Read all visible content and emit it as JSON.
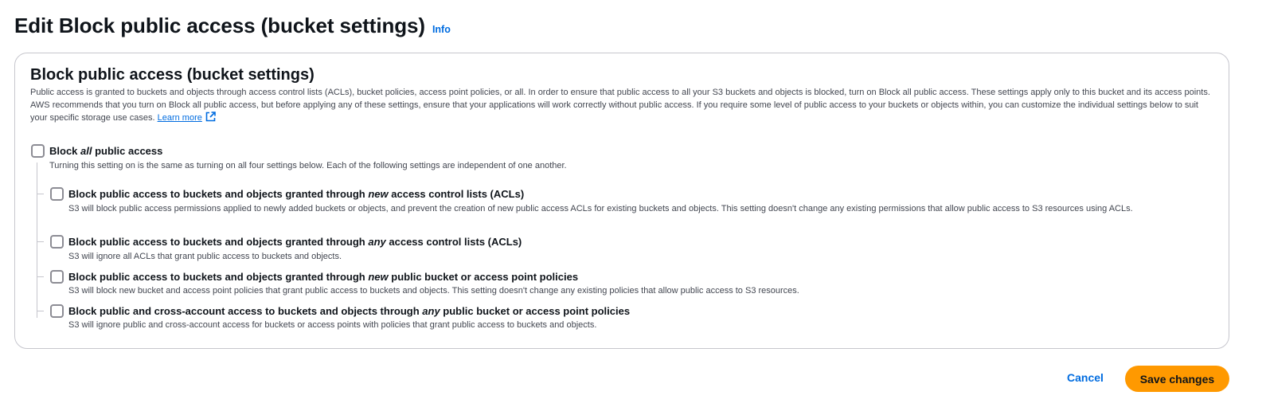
{
  "header": {
    "title": "Edit Block public access (bucket settings)",
    "info_label": "Info"
  },
  "panel": {
    "title": "Block public access (bucket settings)",
    "description": "Public access is granted to buckets and objects through access control lists (ACLs), bucket policies, access point policies, or all. In order to ensure that public access to all your S3 buckets and objects is blocked, turn on Block all public access. These settings apply only to this bucket and its access points. AWS recommends that you turn on Block all public access, but before applying any of these settings, ensure that your applications will work correctly without public access. If you require some level of public access to your buckets or objects within, you can customize the individual settings below to suit your specific storage use cases.",
    "learn_more": "Learn more",
    "external_icon": "external-link-icon"
  },
  "block_all": {
    "label_prefix": "Block ",
    "label_emphasis": "all",
    "label_suffix": " public access",
    "checked": false,
    "description": "Turning this setting on is the same as turning on all four settings below. Each of the following settings are independent of one another."
  },
  "options": [
    {
      "label_prefix": "Block public access to buckets and objects granted through ",
      "label_emphasis": "new",
      "label_suffix": " access control lists (ACLs)",
      "checked": false,
      "description": "S3 will block public access permissions applied to newly added buckets or objects, and prevent the creation of new public access ACLs for existing buckets and objects. This setting doesn't change any existing permissions that allow public access to S3 resources using ACLs."
    },
    {
      "label_prefix": "Block public access to buckets and objects granted through ",
      "label_emphasis": "any",
      "label_suffix": " access control lists (ACLs)",
      "checked": false,
      "description": "S3 will ignore all ACLs that grant public access to buckets and objects."
    },
    {
      "label_prefix": "Block public access to buckets and objects granted through ",
      "label_emphasis": "new",
      "label_suffix": " public bucket or access point policies",
      "checked": false,
      "description": "S3 will block new bucket and access point policies that grant public access to buckets and objects. This setting doesn't change any existing policies that allow public access to S3 resources."
    },
    {
      "label_prefix": "Block public and cross-account access to buckets and objects through ",
      "label_emphasis": "any",
      "label_suffix": " public bucket or access point policies",
      "checked": false,
      "description": "S3 will ignore public and cross-account access for buckets or access points with policies that grant public access to buckets and objects."
    }
  ],
  "footer": {
    "cancel_label": "Cancel",
    "save_label": "Save changes"
  },
  "colors": {
    "link": "#006ce0",
    "primary_button": "#ff9900",
    "border": "#c6c6cd",
    "text": "#0f141a",
    "secondary_text": "#424650"
  }
}
